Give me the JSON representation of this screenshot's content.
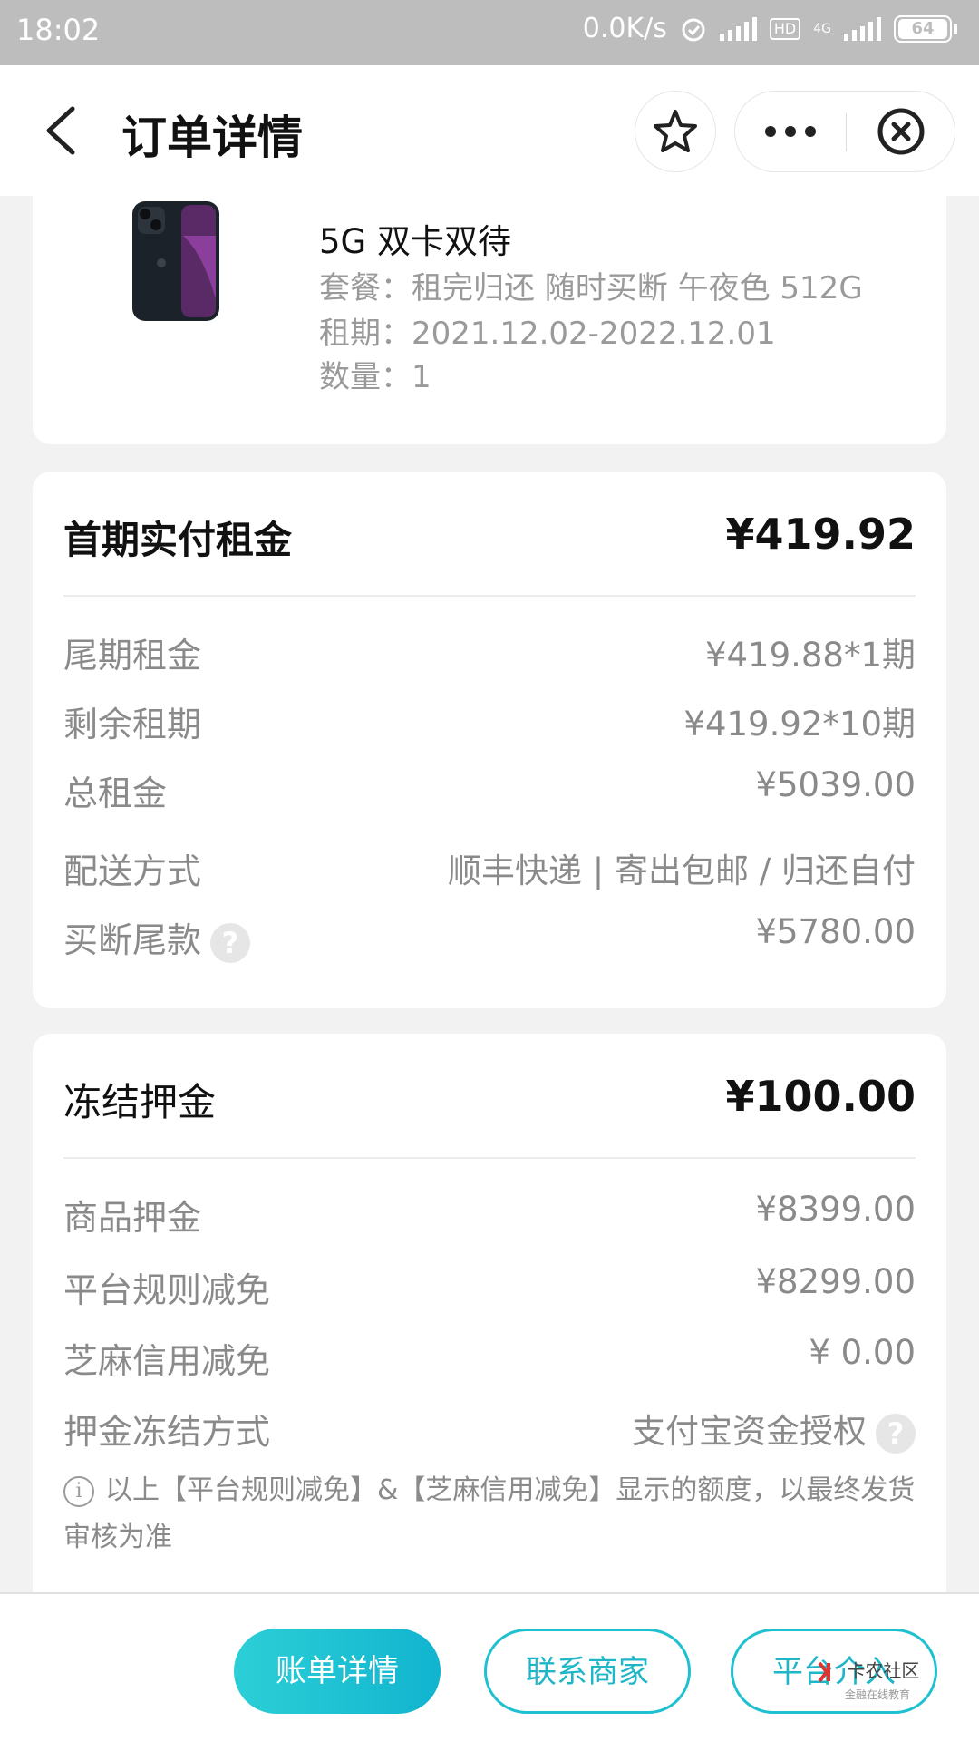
{
  "status_bar": {
    "time": "18:02",
    "speed": "0.0K/s",
    "hd": "HD",
    "network": "4G",
    "battery": "64"
  },
  "nav": {
    "title": "订单详情"
  },
  "product": {
    "name": "5G 双卡双待",
    "plan": "套餐：租完归还 随时买断 午夜色 512G",
    "period": "租期：2021.12.02-2022.12.01",
    "quantity": "数量：1"
  },
  "rent": {
    "title": "首期实付租金",
    "amount": "¥419.92",
    "rows": [
      {
        "label": "尾期租金",
        "value": "¥419.88*1期"
      },
      {
        "label": "剩余租期",
        "value": "¥419.92*10期"
      },
      {
        "label": "总租金",
        "value": "¥5039.00"
      },
      {
        "label": "配送方式",
        "value": "顺丰快递 | 寄出包邮 / 归还自付"
      },
      {
        "label": "买断尾款",
        "value": "¥5780.00"
      }
    ]
  },
  "deposit": {
    "title": "冻结押金",
    "amount": "¥100.00",
    "rows": [
      {
        "label": "商品押金",
        "value": "¥8399.00"
      },
      {
        "label": "平台规则减免",
        "value": "¥8299.00"
      },
      {
        "label": "芝麻信用减免",
        "value": "¥ 0.00"
      },
      {
        "label": "押金冻结方式",
        "value": "支付宝资金授权"
      }
    ],
    "note": "以上【平台规则减免】&【芝麻信用减免】显示的额度，以最终发货审核为准"
  },
  "actions": {
    "bill": "账单详情",
    "contact": "联系商家",
    "platform": "平台介入"
  },
  "watermark": {
    "main": "卡农社区",
    "sub": "金融在线教育"
  },
  "colors": {
    "accent": "#1fc0cf",
    "status_bar": "#bdbdbd",
    "background": "#f2f2f2"
  }
}
